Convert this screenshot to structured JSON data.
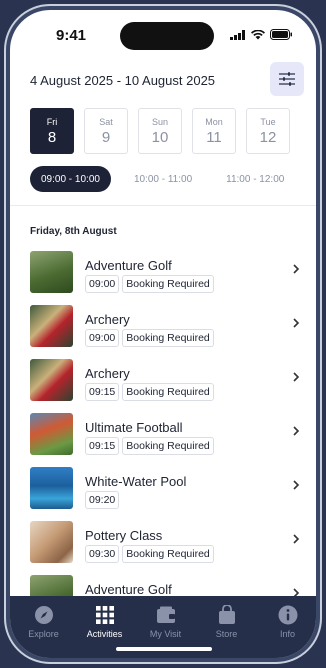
{
  "status": {
    "time": "9:41"
  },
  "header": {
    "date_range": "4 August 2025 - 10 August 2025"
  },
  "days": [
    {
      "dow": "Fri",
      "num": "8",
      "active": true
    },
    {
      "dow": "Sat",
      "num": "9"
    },
    {
      "dow": "Sun",
      "num": "10"
    },
    {
      "dow": "Mon",
      "num": "11"
    },
    {
      "dow": "Tue",
      "num": "12"
    }
  ],
  "slots": [
    {
      "label": "09:00 - 10:00",
      "active": true
    },
    {
      "label": "10:00 - 11:00"
    },
    {
      "label": "11:00 - 12:00"
    }
  ],
  "section": {
    "title": "Friday, 8th August"
  },
  "activities": [
    {
      "title": "Adventure Golf",
      "time": "09:00",
      "tag": "Booking Required"
    },
    {
      "title": "Archery",
      "time": "09:00",
      "tag": "Booking Required"
    },
    {
      "title": "Archery",
      "time": "09:15",
      "tag": "Booking Required"
    },
    {
      "title": "Ultimate Football",
      "time": "09:15",
      "tag": "Booking Required"
    },
    {
      "title": "White-Water Pool",
      "time": "09:20",
      "tag": ""
    },
    {
      "title": "Pottery Class",
      "time": "09:30",
      "tag": "Booking Required"
    },
    {
      "title": "Adventure Golf",
      "time": "",
      "tag": ""
    }
  ],
  "tabs": [
    {
      "label": "Explore",
      "icon": "compass-icon"
    },
    {
      "label": "Activities",
      "icon": "grid-icon",
      "active": true
    },
    {
      "label": "My Visit",
      "icon": "wallet-icon"
    },
    {
      "label": "Store",
      "icon": "bag-icon"
    },
    {
      "label": "Info",
      "icon": "info-icon"
    }
  ],
  "colors": {
    "accent": "#1d2236",
    "tabbar": "#262f49",
    "filter_bg": "#e6e8fa"
  }
}
